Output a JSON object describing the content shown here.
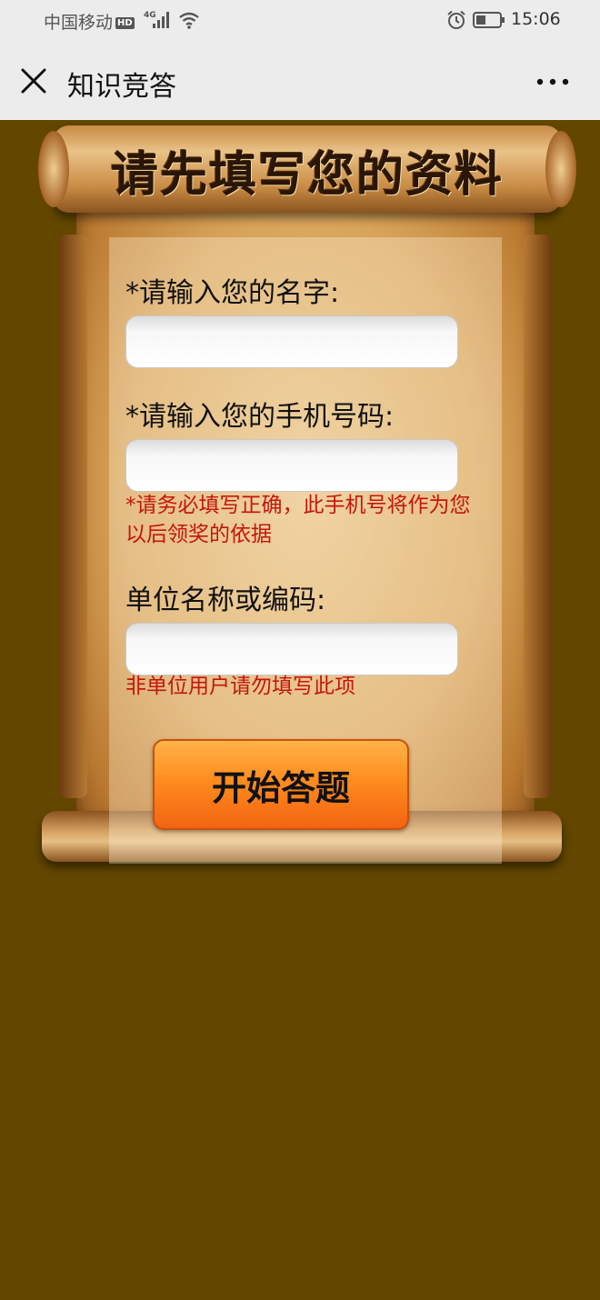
{
  "status_bar": {
    "carrier": "中国移动",
    "hd": "HD",
    "network": "4G",
    "time": "15:06"
  },
  "nav": {
    "title": "知识竞答"
  },
  "scroll": {
    "heading": "请先填写您的资料"
  },
  "form": {
    "name_label": "*请输入您的名字:",
    "name_value": "",
    "phone_label": "*请输入您的手机号码:",
    "phone_value": "",
    "phone_hint": "*请务必填写正确，此手机号将作为您以后领奖的依据",
    "org_label": "单位名称或编码:",
    "org_value": "",
    "org_hint": "非单位用户请勿填写此项",
    "start_button": "开始答题"
  },
  "colors": {
    "page_background": "#634700",
    "hint_text": "#c4160c",
    "button_orange": "#ff8c1f"
  }
}
